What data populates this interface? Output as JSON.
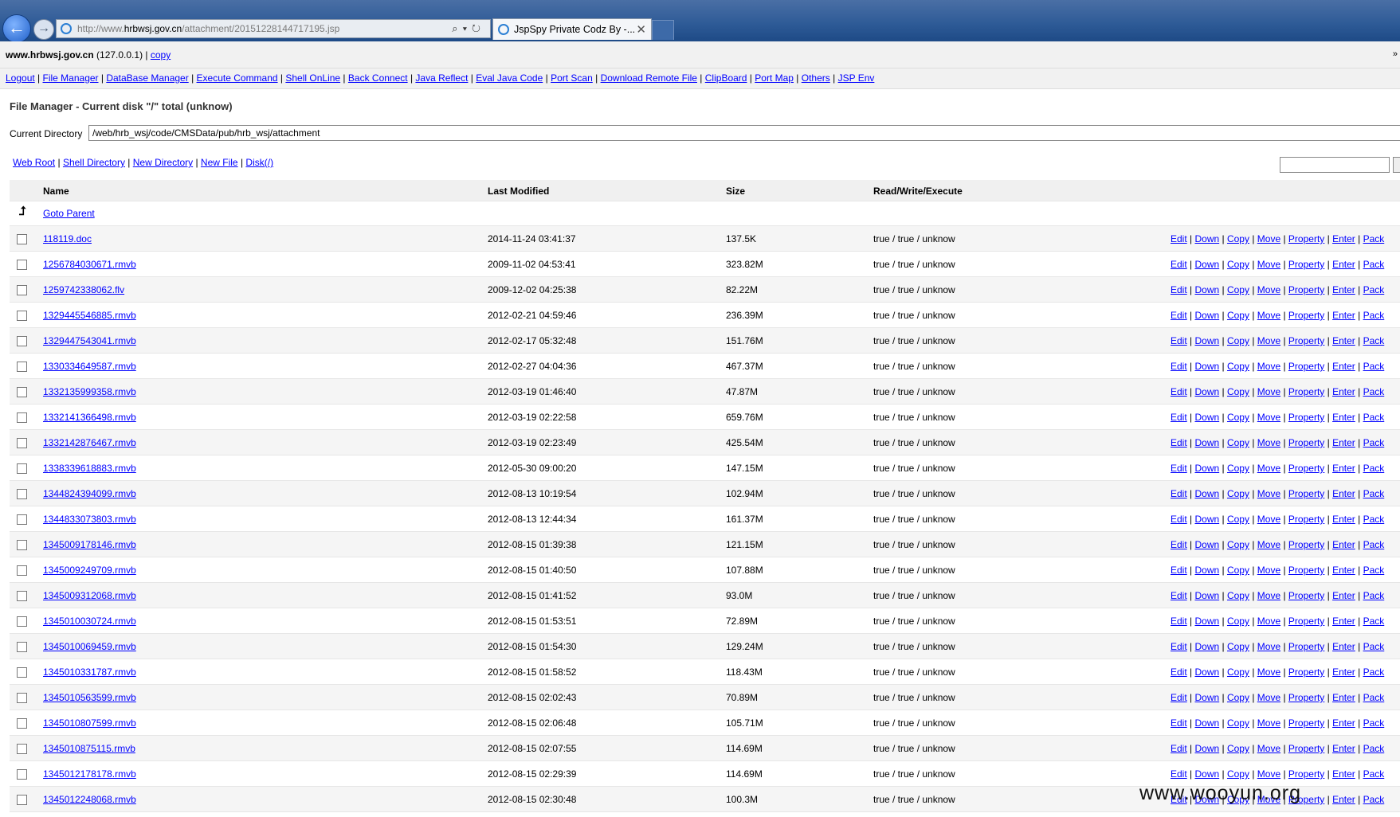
{
  "browser": {
    "url_prefix": "http://www.",
    "url_domain": "hrbwsj.gov.cn",
    "url_path": "/attachment/20151228144717195.jsp",
    "tab_title": "JspSpy Private Codz By -...",
    "back_glyph": "←",
    "forward_glyph": "→",
    "close_glyph": "✕",
    "tools_glyphs": "⌕▾↻"
  },
  "header": {
    "host": "www.hrbwsj.gov.cn",
    "host_ip": " (127.0.0.1) | ",
    "copy_link": "copy",
    "scroll_glyph": "»"
  },
  "nav": [
    "Logout",
    "File Manager",
    "DataBase Manager",
    "Execute Command",
    "Shell OnLine",
    "Back Connect",
    "Java Reflect",
    "Eval Java Code",
    "Port Scan",
    "Download Remote File",
    "ClipBoard",
    "Port Map",
    "Others",
    "JSP Env"
  ],
  "file_manager": {
    "title": "File Manager - Current disk \"/\" total (unknow)",
    "current_dir_label": "Current Directory",
    "current_dir_value": "/web/hrb_wsj/code/CMSData/pub/hrb_wsj/attachment"
  },
  "quick_links": [
    "Web Root",
    "Shell Directory",
    "New Directory",
    "New File",
    "Disk(/)"
  ],
  "table": {
    "columns": {
      "name": "Name",
      "modified": "Last Modified",
      "size": "Size",
      "rwx": "Read/Write/Execute"
    },
    "parent_glyph": "⮥",
    "parent_link": "Goto Parent",
    "actions": [
      "Edit",
      "Down",
      "Copy",
      "Move",
      "Property",
      "Enter",
      "Pack"
    ],
    "rows": [
      {
        "name": "118119.doc",
        "modified": "2014-11-24 03:41:37",
        "size": "137.5K",
        "rwx": "true / true / unknow"
      },
      {
        "name": "1256784030671.rmvb",
        "modified": "2009-11-02 04:53:41",
        "size": "323.82M",
        "rwx": "true / true / unknow"
      },
      {
        "name": "1259742338062.flv",
        "modified": "2009-12-02 04:25:38",
        "size": "82.22M",
        "rwx": "true / true / unknow"
      },
      {
        "name": "1329445546885.rmvb",
        "modified": "2012-02-21 04:59:46",
        "size": "236.39M",
        "rwx": "true / true / unknow"
      },
      {
        "name": "1329447543041.rmvb",
        "modified": "2012-02-17 05:32:48",
        "size": "151.76M",
        "rwx": "true / true / unknow"
      },
      {
        "name": "1330334649587.rmvb",
        "modified": "2012-02-27 04:04:36",
        "size": "467.37M",
        "rwx": "true / true / unknow"
      },
      {
        "name": "1332135999358.rmvb",
        "modified": "2012-03-19 01:46:40",
        "size": "47.87M",
        "rwx": "true / true / unknow"
      },
      {
        "name": "1332141366498.rmvb",
        "modified": "2012-03-19 02:22:58",
        "size": "659.76M",
        "rwx": "true / true / unknow"
      },
      {
        "name": "1332142876467.rmvb",
        "modified": "2012-03-19 02:23:49",
        "size": "425.54M",
        "rwx": "true / true / unknow"
      },
      {
        "name": "1338339618883.rmvb",
        "modified": "2012-05-30 09:00:20",
        "size": "147.15M",
        "rwx": "true / true / unknow"
      },
      {
        "name": "1344824394099.rmvb",
        "modified": "2012-08-13 10:19:54",
        "size": "102.94M",
        "rwx": "true / true / unknow"
      },
      {
        "name": "1344833073803.rmvb",
        "modified": "2012-08-13 12:44:34",
        "size": "161.37M",
        "rwx": "true / true / unknow"
      },
      {
        "name": "1345009178146.rmvb",
        "modified": "2012-08-15 01:39:38",
        "size": "121.15M",
        "rwx": "true / true / unknow"
      },
      {
        "name": "1345009249709.rmvb",
        "modified": "2012-08-15 01:40:50",
        "size": "107.88M",
        "rwx": "true / true / unknow"
      },
      {
        "name": "1345009312068.rmvb",
        "modified": "2012-08-15 01:41:52",
        "size": "93.0M",
        "rwx": "true / true / unknow"
      },
      {
        "name": "1345010030724.rmvb",
        "modified": "2012-08-15 01:53:51",
        "size": "72.89M",
        "rwx": "true / true / unknow"
      },
      {
        "name": "1345010069459.rmvb",
        "modified": "2012-08-15 01:54:30",
        "size": "129.24M",
        "rwx": "true / true / unknow"
      },
      {
        "name": "1345010331787.rmvb",
        "modified": "2012-08-15 01:58:52",
        "size": "118.43M",
        "rwx": "true / true / unknow"
      },
      {
        "name": "1345010563599.rmvb",
        "modified": "2012-08-15 02:02:43",
        "size": "70.89M",
        "rwx": "true / true / unknow"
      },
      {
        "name": "1345010807599.rmvb",
        "modified": "2012-08-15 02:06:48",
        "size": "105.71M",
        "rwx": "true / true / unknow"
      },
      {
        "name": "1345010875115.rmvb",
        "modified": "2012-08-15 02:07:55",
        "size": "114.69M",
        "rwx": "true / true / unknow"
      },
      {
        "name": "1345012178178.rmvb",
        "modified": "2012-08-15 02:29:39",
        "size": "114.69M",
        "rwx": "true / true / unknow"
      },
      {
        "name": "1345012248068.rmvb",
        "modified": "2012-08-15 02:30:48",
        "size": "100.3M",
        "rwx": "true / true / unknow"
      }
    ]
  },
  "watermark": "www.wooyun.org"
}
